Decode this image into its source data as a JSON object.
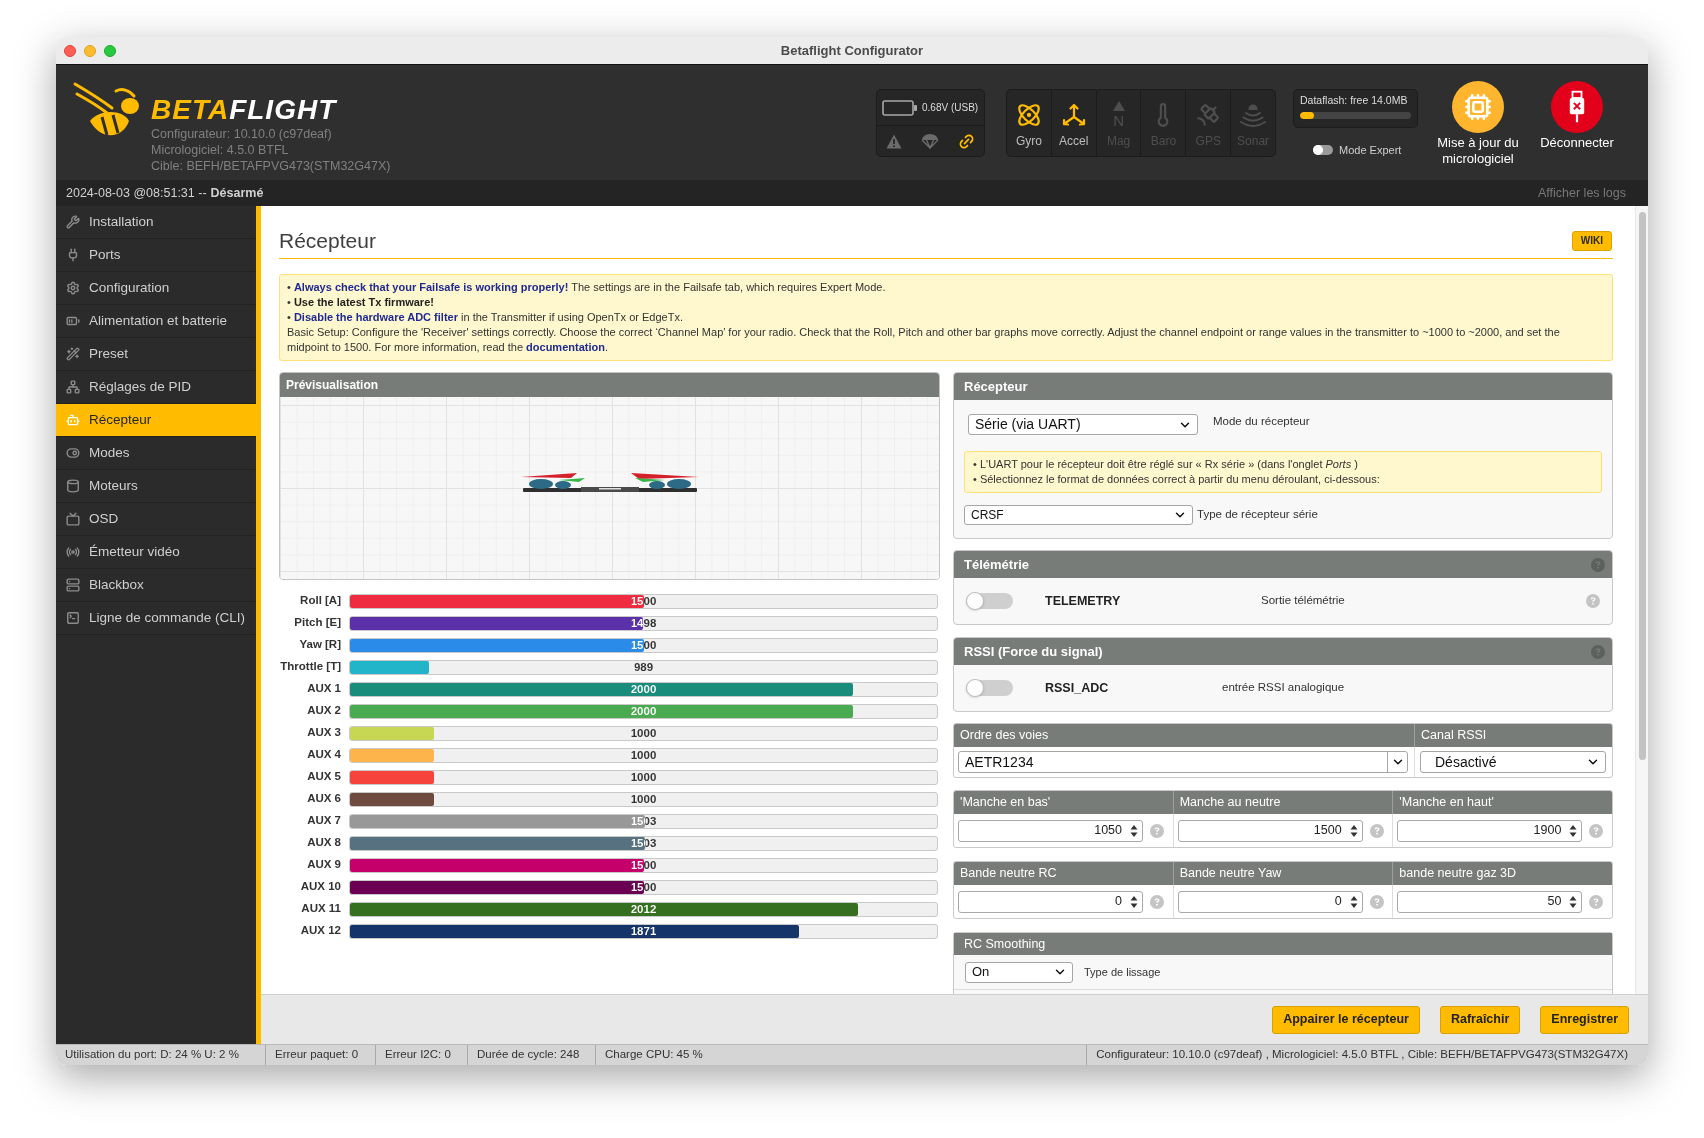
{
  "window": {
    "title": "Betaflight Configurator"
  },
  "header": {
    "logo": [
      "BETA",
      "FLIGHT"
    ],
    "versions": [
      "Configurateur: 10.10.0 (c97deaf)",
      "Micrologiciel: 4.5.0 BTFL",
      "Cible: BEFH/BETAFPVG473(STM32G47X)"
    ],
    "battery": {
      "reading": "0.68V (USB)"
    },
    "indicators": [
      {
        "kind": "warning",
        "active": false
      },
      {
        "kind": "failsafe",
        "active": false
      },
      {
        "kind": "link",
        "active": true
      }
    ],
    "sensors": [
      {
        "kind": "gyro",
        "label": "Gyro",
        "active": true
      },
      {
        "kind": "accel",
        "label": "Accel",
        "active": true
      },
      {
        "kind": "mag",
        "label": "Mag",
        "glyph": "N",
        "active": false
      },
      {
        "kind": "baro",
        "label": "Baro",
        "active": false
      },
      {
        "kind": "gps",
        "label": "GPS",
        "active": false
      },
      {
        "kind": "sonar",
        "label": "Sonar",
        "active": false
      }
    ],
    "dataflash": {
      "label": "Dataflash: free 14.0MB",
      "level": 0.13
    },
    "expert_mode": {
      "label": "Mode Expert",
      "on": false
    },
    "actions": [
      {
        "kind": "flash",
        "label": "Mise à jour du micrologiciel"
      },
      {
        "kind": "disconnect",
        "label": "Déconnecter"
      }
    ]
  },
  "status_line": {
    "timestamp": "2024-08-03 @08:51:31 --",
    "state": "Désarmé",
    "logs": "Afficher les logs"
  },
  "sidebar": {
    "items": [
      {
        "label": "Installation",
        "selected": false
      },
      {
        "label": "Ports",
        "selected": false
      },
      {
        "label": "Configuration",
        "selected": false
      },
      {
        "label": "Alimentation et batterie",
        "selected": false
      },
      {
        "label": "Preset",
        "selected": false
      },
      {
        "label": "Réglages de PID",
        "selected": false
      },
      {
        "label": "Récepteur",
        "selected": true
      },
      {
        "label": "Modes",
        "selected": false
      },
      {
        "label": "Moteurs",
        "selected": false
      },
      {
        "label": "OSD",
        "selected": false
      },
      {
        "label": "Émetteur vidéo",
        "selected": false
      },
      {
        "label": "Blackbox",
        "selected": false
      },
      {
        "label": "Ligne de commande (CLI)",
        "selected": false
      }
    ]
  },
  "page": {
    "title": "Récepteur",
    "wiki": "WIKI"
  },
  "notice": {
    "lines": [
      {
        "kind": "highlight",
        "text": "• **Always check that your Failsafe is working properly!** The settings are in the Failsafe tab, which requires Expert Mode."
      },
      {
        "kind": "plain",
        "text": "• **Use the latest Tx firmware!**"
      },
      {
        "kind": "highlight",
        "text": "• **Disable the hardware ADC filter** in the Transmitter if using OpenTx or EdgeTx."
      }
    ],
    "setup": {
      "text": "Basic Setup: Configure the 'Receiver' settings correctly. Choose the correct ‘Channel Map’ for your radio. Check that the Roll, Pitch and other bar graphs move correctly. Adjust the channel endpoint or range values in the transmitter to ~1000 to ~2000, and set the midpoint to 1500. For more information, read the",
      "link": "documentation",
      "end": "."
    }
  },
  "preview": {
    "title": "Prévisualisation"
  },
  "channels": [
    {
      "name": "Roll [A]",
      "reading": "1500",
      "level": 0.5,
      "color": "#ee2b3f"
    },
    {
      "name": "Pitch [E]",
      "reading": "1498",
      "level": 0.499,
      "color": "#5c30a9"
    },
    {
      "name": "Yaw [R]",
      "reading": "1500",
      "level": 0.5,
      "color": "#2a8ce8"
    },
    {
      "name": "Throttle [T]",
      "reading": "989",
      "level": 0.135,
      "color": "#22b5c9"
    },
    {
      "name": "AUX 1",
      "reading": "2000",
      "level": 0.857,
      "color": "#1a8c7b"
    },
    {
      "name": "AUX 2",
      "reading": "2000",
      "level": 0.857,
      "color": "#4aaa51"
    },
    {
      "name": "AUX 3",
      "reading": "1000",
      "level": 0.143,
      "color": "#c7d653"
    },
    {
      "name": "AUX 4",
      "reading": "1000",
      "level": 0.143,
      "color": "#fdb54b"
    },
    {
      "name": "AUX 5",
      "reading": "1000",
      "level": 0.143,
      "color": "#f6433c"
    },
    {
      "name": "AUX 6",
      "reading": "1000",
      "level": 0.143,
      "color": "#6e4a41"
    },
    {
      "name": "AUX 7",
      "reading": "1503",
      "level": 0.502,
      "color": "#989898"
    },
    {
      "name": "AUX 8",
      "reading": "1503",
      "level": 0.502,
      "color": "#577180"
    },
    {
      "name": "AUX 9",
      "reading": "1500",
      "level": 0.5,
      "color": "#c5006b"
    },
    {
      "name": "AUX 10",
      "reading": "1500",
      "level": 0.5,
      "color": "#6b0052"
    },
    {
      "name": "AUX 11",
      "reading": "2012",
      "level": 0.866,
      "color": "#347020"
    },
    {
      "name": "AUX 12",
      "reading": "1871",
      "level": 0.765,
      "color": "#15356a"
    }
  ],
  "receiver": {
    "title": "Récepteur",
    "mode": {
      "value": "Série (via UART)",
      "label": "Mode du récepteur"
    },
    "notes": [
      "• L'UART pour le récepteur doit être réglé sur « Rx série » (dans l'onglet *Ports* )",
      "• Sélectionnez le format de données correct à partir du menu déroulant, ci-dessous:"
    ],
    "provider": {
      "value": "CRSF",
      "label": "Type de récepteur série"
    }
  },
  "telemetry": {
    "title": "Télémétrie",
    "feature": {
      "name": "TELEMETRY",
      "description": "Sortie télémétrie",
      "on": false
    }
  },
  "rssi": {
    "title": "RSSI (Force du signal)",
    "feature": {
      "name": "RSSI_ADC",
      "description": "entrée RSSI analogique",
      "on": false
    }
  },
  "channel_map": {
    "columns": [
      "Ordre des voies",
      "Canal RSSI"
    ],
    "values": [
      "AETR1234",
      "Désactivé"
    ]
  },
  "stick_limits": {
    "columns": [
      "'Manche en bas'",
      "Manche au neutre",
      "'Manche en haut'"
    ],
    "values": [
      "1050",
      "1500",
      "1900"
    ]
  },
  "deadbands": {
    "columns": [
      "Bande neutre RC",
      "Bande neutre Yaw",
      "bande neutre gaz 3D"
    ],
    "values": [
      "0",
      "0",
      "50"
    ]
  },
  "rc_smoothing": {
    "title": "RC Smoothing",
    "type": {
      "value": "On",
      "label": "Type de lissage"
    }
  },
  "buttons": [
    "Appairer le récepteur",
    "Rafraîchir",
    "Enregistrer"
  ],
  "status_bar": {
    "items": [
      "Utilisation du port: D: 24 % U: 2 %",
      "Erreur paquet: 0",
      "Erreur I2C: 0",
      "Durée de cycle: 248",
      "Charge CPU: 45 %"
    ],
    "versions": "Configurateur: 10.10.0 (c97deaf) , Micrologiciel: 4.5.0 BTFL , Cible: BEFH/BETAFPVG473(STM32G47X)"
  }
}
